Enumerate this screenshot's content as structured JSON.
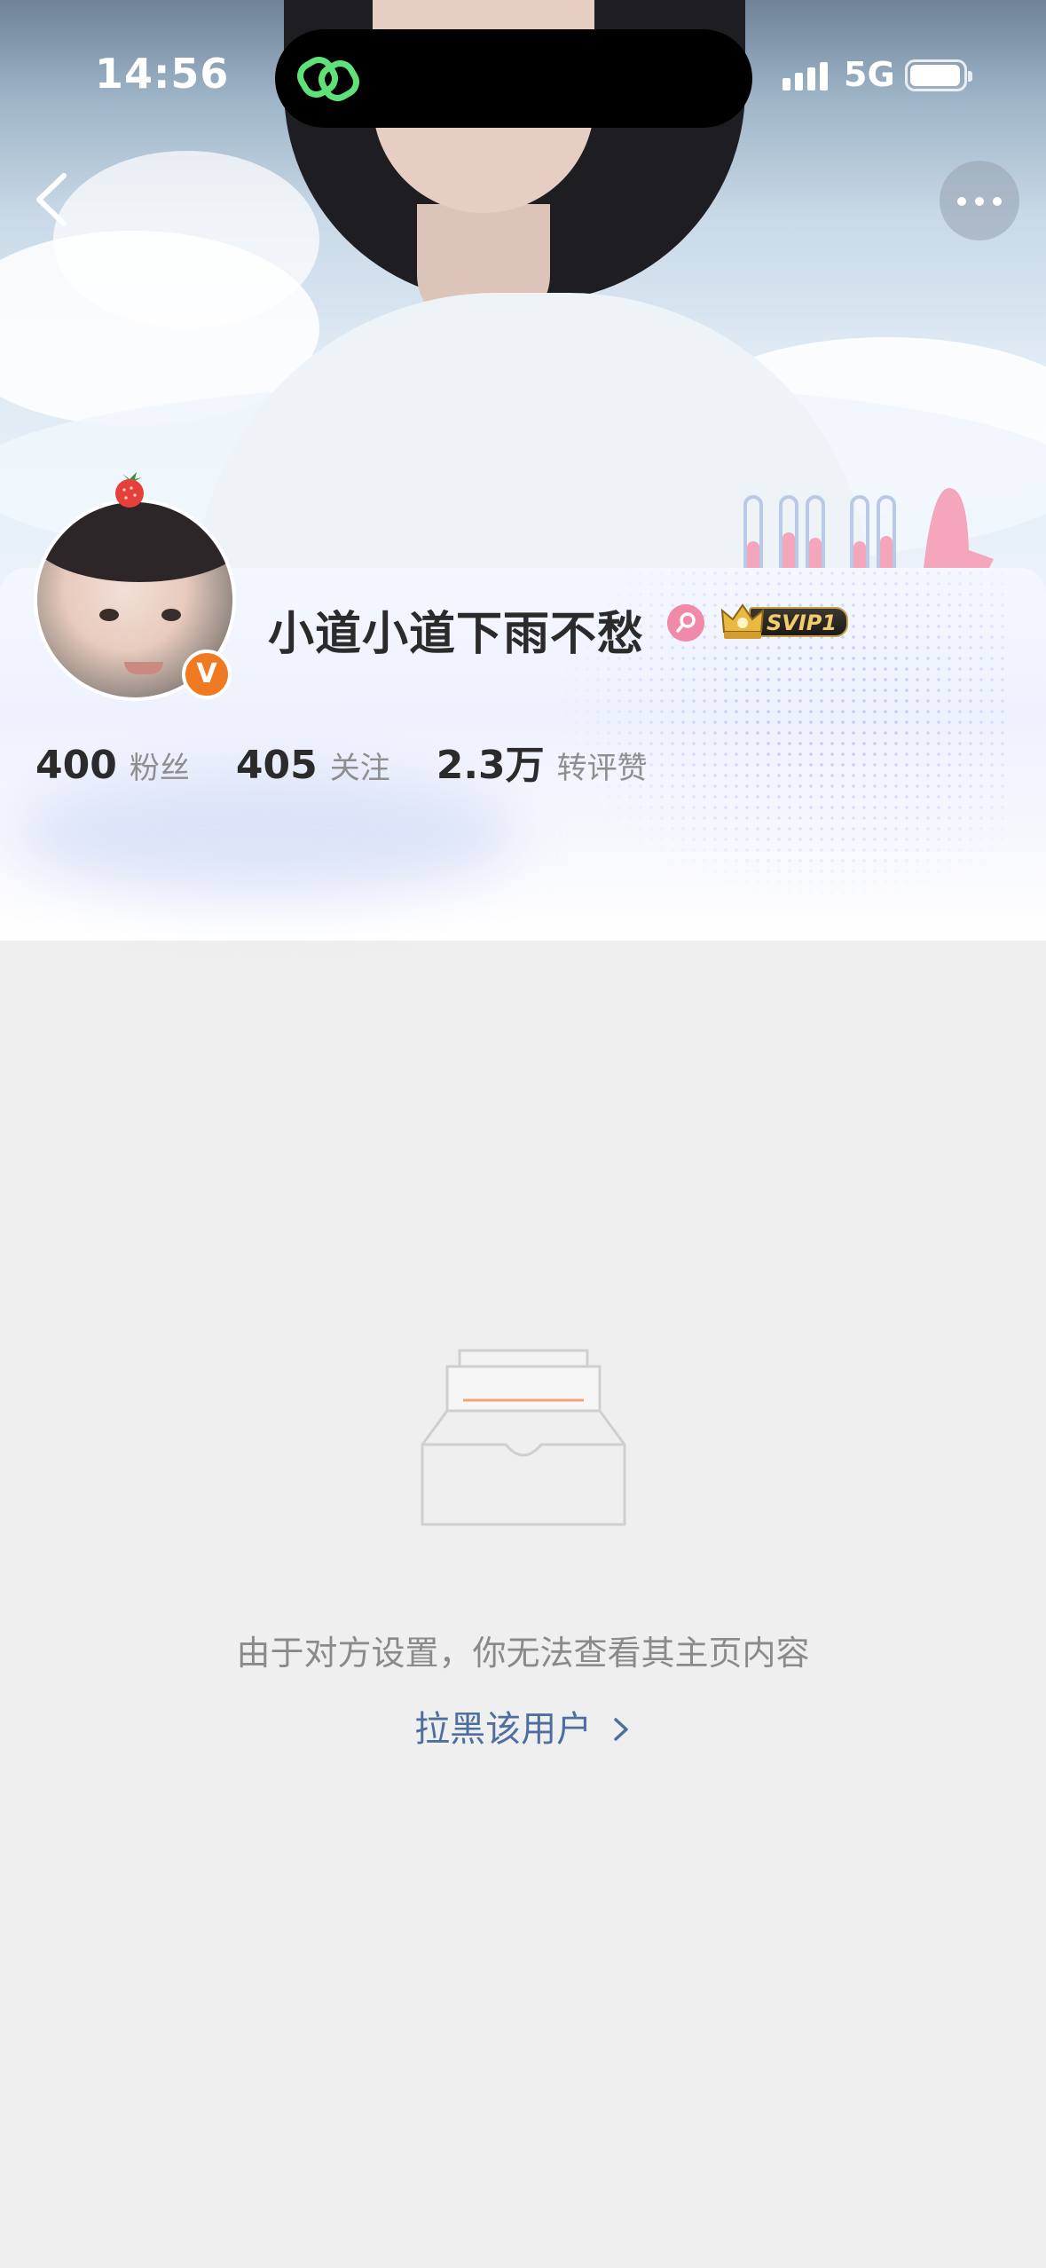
{
  "status_bar": {
    "time": "14:56",
    "network": "5G",
    "battery_level": 0.85,
    "icons": [
      "link-activity-icon",
      "signal-icon",
      "battery-icon"
    ]
  },
  "nav": {
    "back_icon": "chevron-left-icon",
    "more_icon": "more-dots-icon"
  },
  "profile": {
    "username": "小道小道下雨不愁",
    "verified_badge": "V",
    "badges": [
      "pink-search-badge",
      "svip-crown-badge"
    ],
    "svip_label": "SVIP1",
    "stats": [
      {
        "value": "400",
        "label": "粉丝"
      },
      {
        "value": "405",
        "label": "关注"
      },
      {
        "value": "2.3万",
        "label": "转评赞"
      }
    ]
  },
  "empty_state": {
    "icon": "empty-inbox-icon",
    "message": "由于对方设置，你无法查看其主页内容",
    "action_label": "拉黑该用户",
    "action_icon": "chevron-right-icon"
  },
  "colors": {
    "background": "#efefef",
    "link": "#4d6fa0",
    "verified": "#ef7a22",
    "island_icon": "#5fe17a"
  }
}
